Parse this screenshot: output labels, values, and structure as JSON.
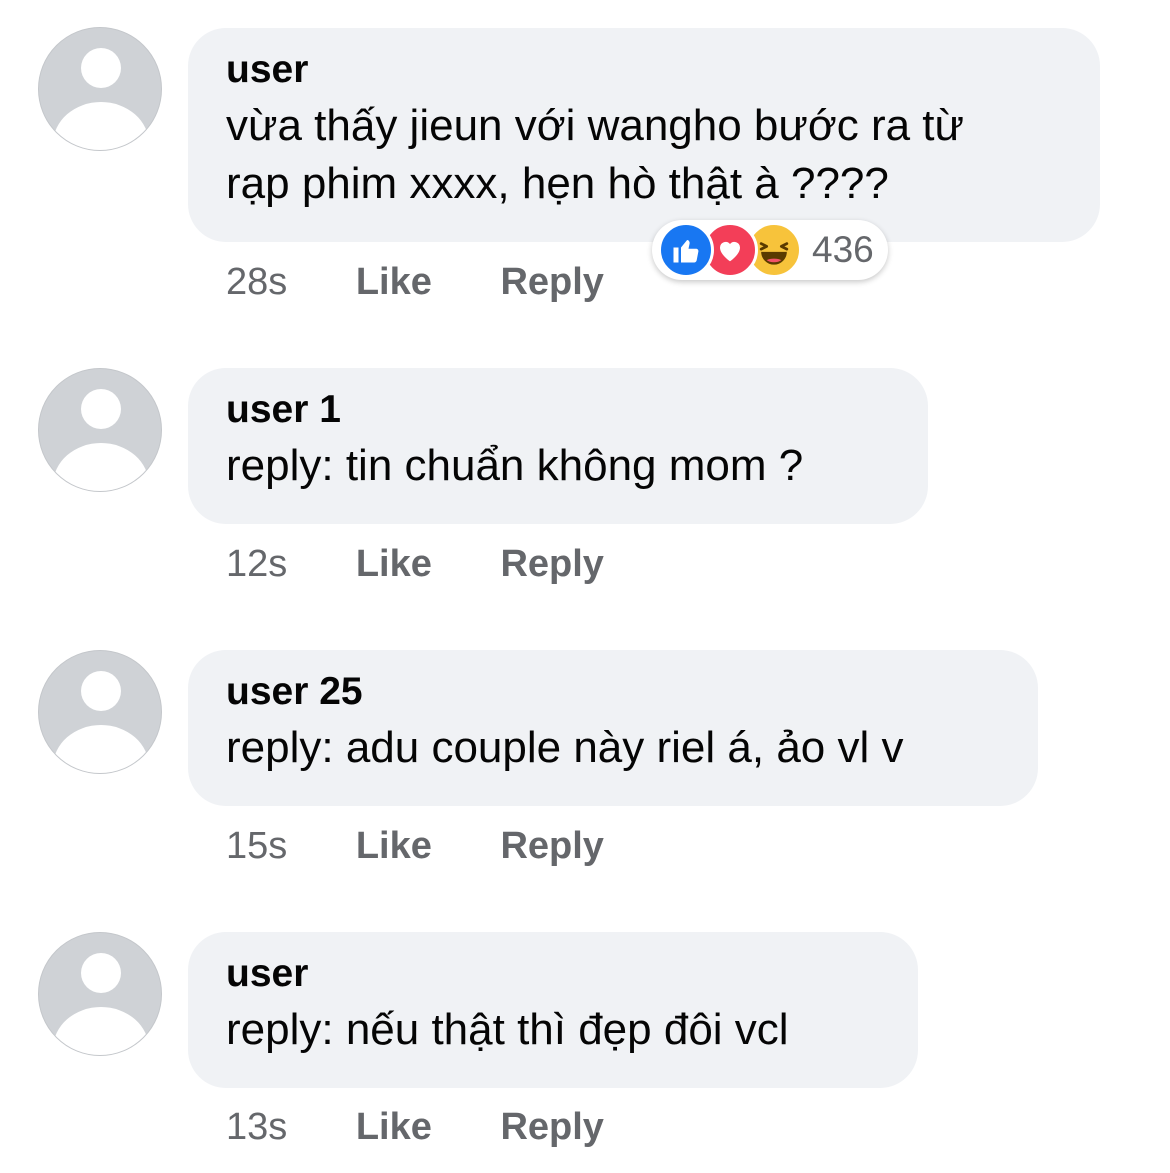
{
  "comments": [
    {
      "name": "user",
      "lines": [
        "vừa thấy jieun với wangho bước ra từ",
        "rạp phim xxxx, hẹn hò thật à ????"
      ],
      "time": "28s",
      "like": "Like",
      "reply": "Reply",
      "reactions": {
        "icons": [
          "like-icon",
          "love-icon",
          "haha-icon"
        ],
        "count": "436"
      }
    },
    {
      "name": "user 1",
      "lines": [
        "reply: tin chuẩn không mom ?"
      ],
      "time": "12s",
      "like": "Like",
      "reply": "Reply"
    },
    {
      "name": "user 25",
      "lines": [
        "reply: adu couple này riel á, ảo vl v"
      ],
      "time": "15s",
      "like": "Like",
      "reply": "Reply"
    },
    {
      "name": "user",
      "lines": [
        "reply: nếu thật thì đẹp đôi vcl"
      ],
      "time": "13s",
      "like": "Like",
      "reply": "Reply"
    }
  ],
  "colors": {
    "bubble": "#f0f2f5",
    "meta_text": "#65676b",
    "like_reaction": "#1877f2",
    "love_reaction": "#f33e58",
    "haha_reaction": "#f7c33b"
  }
}
